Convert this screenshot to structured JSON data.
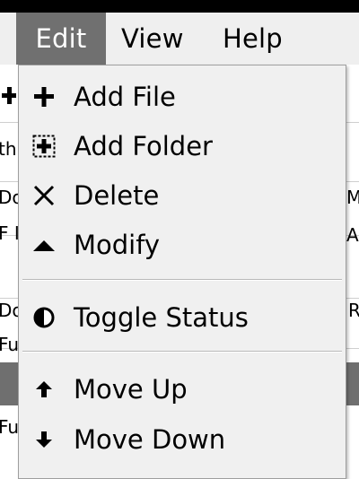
{
  "menubar": {
    "items": [
      {
        "label": "Edit"
      },
      {
        "label": "View"
      },
      {
        "label": "Help"
      }
    ]
  },
  "background": {
    "fragments": [
      "th",
      "Do",
      "F I",
      "My",
      "A",
      "Do",
      "R",
      "Fu",
      "Fu"
    ]
  },
  "edit_menu": {
    "items": [
      {
        "label": "Add File",
        "icon": "plus-icon"
      },
      {
        "label": "Add Folder",
        "icon": "add-folder-icon"
      },
      {
        "label": "Delete",
        "icon": "x-icon"
      },
      {
        "label": "Modify",
        "icon": "triangle-up-icon"
      },
      {
        "label": "Toggle Status",
        "icon": "half-circle-icon"
      },
      {
        "label": "Move Up",
        "icon": "arrow-up-icon"
      },
      {
        "label": "Move Down",
        "icon": "arrow-down-icon"
      }
    ]
  }
}
